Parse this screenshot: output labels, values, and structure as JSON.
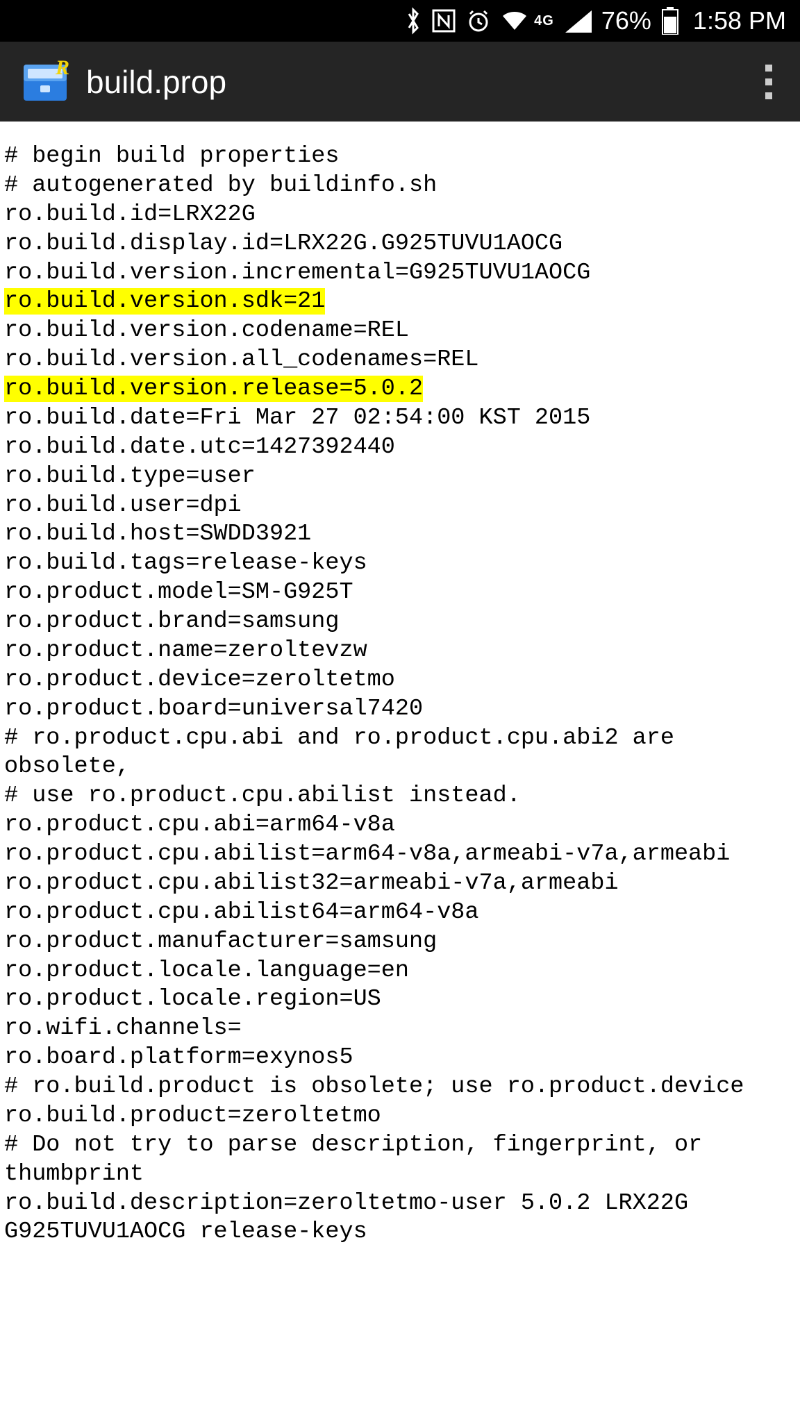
{
  "status": {
    "network_label": "4G",
    "battery_percent": "76%",
    "time": "1:58 PM"
  },
  "app": {
    "title": "build.prop"
  },
  "file": {
    "lines": [
      {
        "text": "# begin build properties",
        "hl": false
      },
      {
        "text": "# autogenerated by buildinfo.sh",
        "hl": false
      },
      {
        "text": "ro.build.id=LRX22G",
        "hl": false
      },
      {
        "text": "ro.build.display.id=LRX22G.G925TUVU1AOCG",
        "hl": false
      },
      {
        "text": "ro.build.version.incremental=G925TUVU1AOCG",
        "hl": false
      },
      {
        "text": "ro.build.version.sdk=21",
        "hl": true
      },
      {
        "text": "ro.build.version.codename=REL",
        "hl": false
      },
      {
        "text": "ro.build.version.all_codenames=REL",
        "hl": false
      },
      {
        "text": "ro.build.version.release=5.0.2",
        "hl": true
      },
      {
        "text": "ro.build.date=Fri Mar 27 02:54:00 KST 2015",
        "hl": false
      },
      {
        "text": "ro.build.date.utc=1427392440",
        "hl": false
      },
      {
        "text": "ro.build.type=user",
        "hl": false
      },
      {
        "text": "ro.build.user=dpi",
        "hl": false
      },
      {
        "text": "ro.build.host=SWDD3921",
        "hl": false
      },
      {
        "text": "ro.build.tags=release-keys",
        "hl": false
      },
      {
        "text": "ro.product.model=SM-G925T",
        "hl": false
      },
      {
        "text": "ro.product.brand=samsung",
        "hl": false
      },
      {
        "text": "ro.product.name=zeroltevzw",
        "hl": false
      },
      {
        "text": "ro.product.device=zeroltetmo",
        "hl": false
      },
      {
        "text": "ro.product.board=universal7420",
        "hl": false
      },
      {
        "text": "# ro.product.cpu.abi and ro.product.cpu.abi2 are obsolete,",
        "hl": false
      },
      {
        "text": "# use ro.product.cpu.abilist instead.",
        "hl": false
      },
      {
        "text": "ro.product.cpu.abi=arm64-v8a",
        "hl": false
      },
      {
        "text": "ro.product.cpu.abilist=arm64-v8a,armeabi-v7a,armeabi",
        "hl": false
      },
      {
        "text": "ro.product.cpu.abilist32=armeabi-v7a,armeabi",
        "hl": false
      },
      {
        "text": "ro.product.cpu.abilist64=arm64-v8a",
        "hl": false
      },
      {
        "text": "ro.product.manufacturer=samsung",
        "hl": false
      },
      {
        "text": "ro.product.locale.language=en",
        "hl": false
      },
      {
        "text": "ro.product.locale.region=US",
        "hl": false
      },
      {
        "text": "ro.wifi.channels=",
        "hl": false
      },
      {
        "text": "ro.board.platform=exynos5",
        "hl": false
      },
      {
        "text": "# ro.build.product is obsolete; use ro.product.device",
        "hl": false
      },
      {
        "text": "ro.build.product=zeroltetmo",
        "hl": false
      },
      {
        "text": "# Do not try to parse description, fingerprint, or thumbprint",
        "hl": false
      },
      {
        "text": "ro.build.description=zeroltetmo-user 5.0.2 LRX22G G925TUVU1AOCG release-keys",
        "hl": false
      }
    ]
  }
}
